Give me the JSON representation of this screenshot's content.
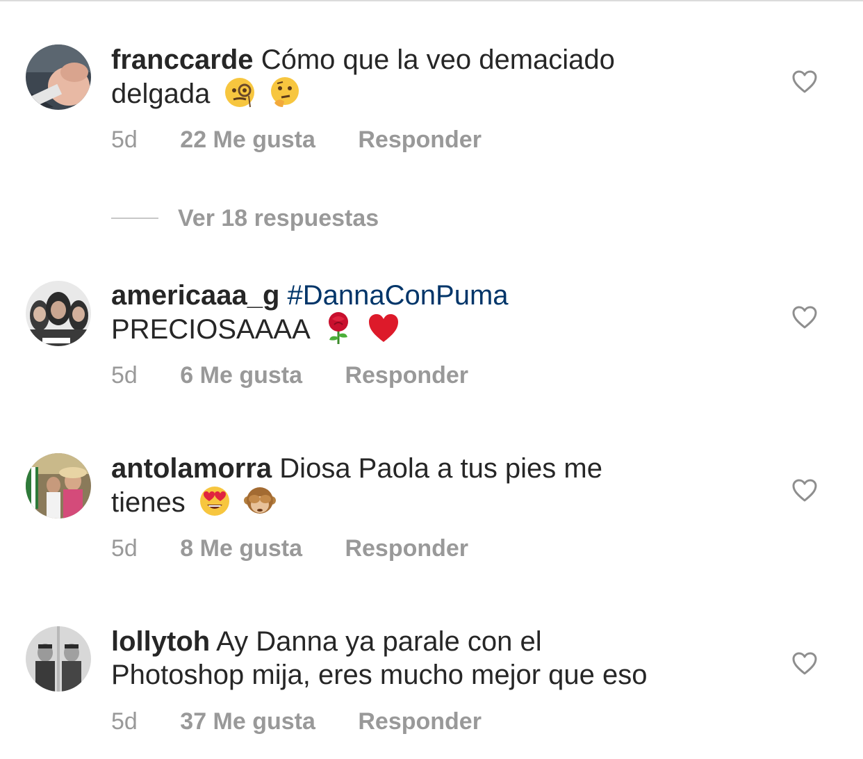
{
  "comments": [
    {
      "username": "franccarde",
      "text_line1": "Cómo que la veo demaciado",
      "text_line2": "delgada",
      "emojis": [
        "face-with-monocle",
        "thinking-face"
      ],
      "time": "5d",
      "likes": "22 Me gusta",
      "reply": "Responder"
    },
    {
      "username": "americaaa_g",
      "hashtag": "#DannaConPuma",
      "text_line2": "PRECIOSAAAA",
      "emojis": [
        "rose",
        "red-heart"
      ],
      "time": "5d",
      "likes": "6 Me gusta",
      "reply": "Responder"
    },
    {
      "username": "antolamorra",
      "text_line1": "Diosa Paola a tus pies me",
      "text_line2": "tienes",
      "emojis": [
        "heart-eyes-face",
        "see-no-evil-monkey"
      ],
      "time": "5d",
      "likes": "8 Me gusta",
      "reply": "Responder"
    },
    {
      "username": "lollytoh",
      "text_line1": "Ay Danna ya parale con el",
      "text_line2": "Photoshop mija, eres mucho mejor que eso",
      "time": "5d",
      "likes": "37 Me gusta",
      "reply": "Responder"
    }
  ],
  "view_replies": "Ver 18 respuestas",
  "colors": {
    "text": "#262626",
    "meta": "#999999",
    "hashtag": "#003569"
  }
}
